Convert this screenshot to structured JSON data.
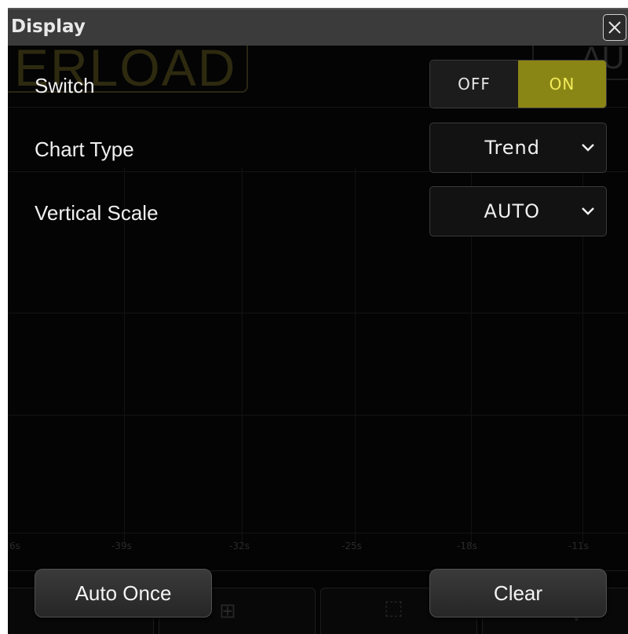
{
  "dialog": {
    "title": "Display",
    "close_icon": "close-icon"
  },
  "background": {
    "status_text": "ERLOAD",
    "corner_text": "AU",
    "time_axis": [
      "6s",
      "-39s",
      "-32s",
      "-25s",
      "-18s",
      "-11s"
    ]
  },
  "settings": {
    "switch": {
      "label": "Switch",
      "off_label": "OFF",
      "on_label": "ON",
      "selected": "ON",
      "active_color": "#8a8616"
    },
    "chart_type": {
      "label": "Chart Type",
      "value": "Trend",
      "icon": "chevron-down-icon"
    },
    "vertical_scale": {
      "label": "Vertical Scale",
      "value": "AUTO",
      "icon": "chevron-down-icon"
    }
  },
  "actions": {
    "auto_once_label": "Auto Once",
    "clear_label": "Clear"
  }
}
